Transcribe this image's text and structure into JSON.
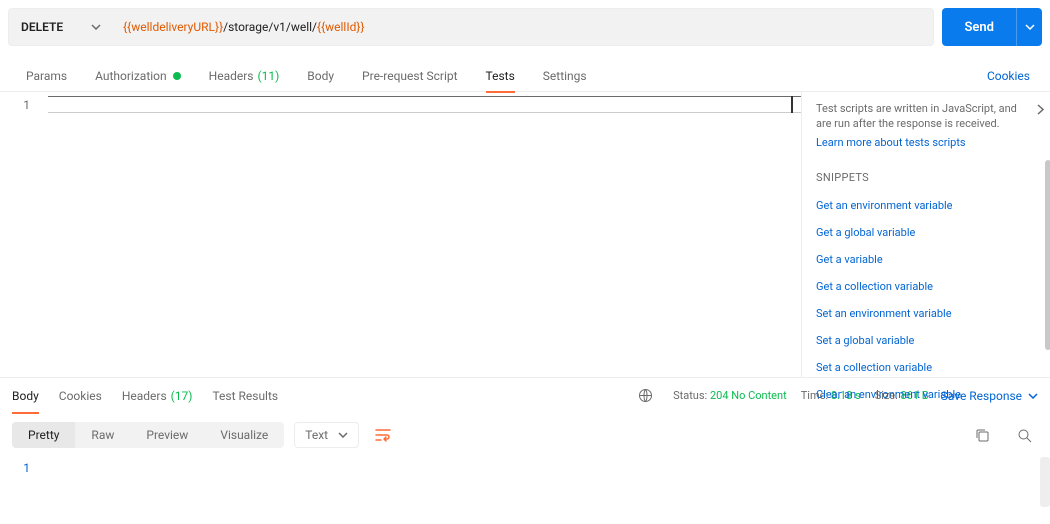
{
  "request": {
    "method": "DELETE",
    "url_var1": "{{welldeliveryURL}}",
    "url_path": "/storage/v1/well/",
    "url_var2": "{{wellId}}",
    "send_label": "Send"
  },
  "req_tabs": {
    "params": "Params",
    "authorization": "Authorization",
    "headers": "Headers",
    "headers_count": "(11)",
    "body": "Body",
    "pre": "Pre-request Script",
    "tests": "Tests",
    "settings": "Settings",
    "cookies": "Cookies"
  },
  "editor": {
    "line1": "1"
  },
  "side": {
    "desc": "Test scripts are written in JavaScript, and are run after the response is received.",
    "learn": "Learn more about tests scripts",
    "snip_head": "SNIPPETS",
    "snips": [
      "Get an environment variable",
      "Get a global variable",
      "Get a variable",
      "Get a collection variable",
      "Set an environment variable",
      "Set a global variable",
      "Set a collection variable",
      "Clear an environment variable"
    ]
  },
  "resp_tabs": {
    "body": "Body",
    "cookies": "Cookies",
    "headers": "Headers",
    "headers_count": "(17)",
    "tests": "Test Results"
  },
  "meta": {
    "status_lbl": "Status:",
    "status_val": "204 No Content",
    "time_lbl": "Time:",
    "time_val": "8.18 s",
    "size_lbl": "Size:",
    "size_val": "861 B",
    "save": "Save Response"
  },
  "view": {
    "pretty": "Pretty",
    "raw": "Raw",
    "preview": "Preview",
    "visualize": "Visualize",
    "format": "Text"
  },
  "resp_editor": {
    "line1": "1"
  }
}
